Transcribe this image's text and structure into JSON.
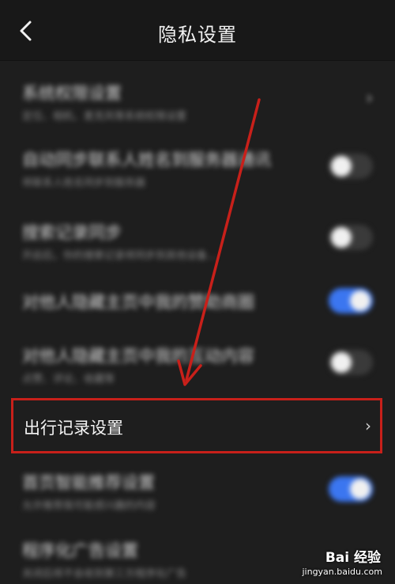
{
  "header": {
    "title": "隐私设置",
    "back_icon": "chevron-left-icon"
  },
  "items": [
    {
      "title": "系统权限设置",
      "subtitle": "定位、相机、麦克风等系统权限设置",
      "control": "chevron"
    },
    {
      "title": "自动同步联系人姓名到服务器通讯",
      "subtitle": "将联系人姓名同步到服务器",
      "control": "toggle",
      "on": false
    },
    {
      "title": "搜索记录同步",
      "subtitle": "开启后，你的搜索记录将同步到其他设备…",
      "control": "toggle",
      "on": false
    },
    {
      "title": "对他人隐藏主页中我的赞助商圈",
      "subtitle": "",
      "control": "toggle",
      "on": true
    },
    {
      "title": "对他人隐藏主页中我的互动内容",
      "subtitle": "点赞、评论、收藏等",
      "control": "toggle",
      "on": false
    },
    {
      "title": "首页智能推荐设置",
      "subtitle": "允许推荐我可能感兴趣的内容",
      "control": "toggle",
      "on": true
    },
    {
      "title": "程序化广告设置",
      "subtitle": "关闭后将不会收到第三方程序化广告",
      "control": "none"
    }
  ],
  "highlighted_item": {
    "title": "出行记录设置",
    "chevron": "›"
  },
  "colors": {
    "accent": "#3b76f0",
    "highlight_border": "#c8201a",
    "background": "#1e1e1e"
  },
  "watermark": {
    "brand": "Bai 经验",
    "url": "jingyan.baidu.com"
  }
}
